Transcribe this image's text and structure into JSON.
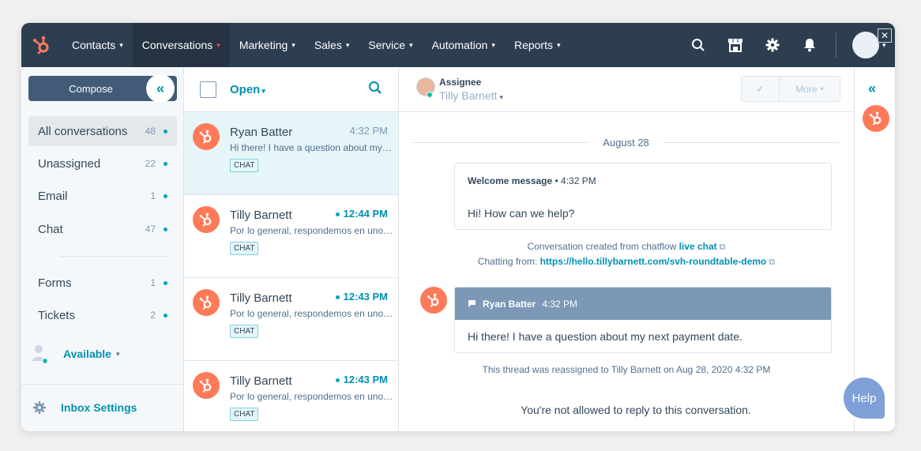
{
  "nav": {
    "items": [
      {
        "label": "Contacts"
      },
      {
        "label": "Conversations"
      },
      {
        "label": "Marketing"
      },
      {
        "label": "Sales"
      },
      {
        "label": "Service"
      },
      {
        "label": "Automation"
      },
      {
        "label": "Reports"
      }
    ],
    "active": "Conversations",
    "icons": [
      "search-icon",
      "marketplace-icon",
      "gear-icon",
      "bell-icon"
    ]
  },
  "sidebar": {
    "compose_label": "Compose",
    "items": [
      {
        "label": "All conversations",
        "count": "48"
      },
      {
        "label": "Unassigned",
        "count": "22"
      },
      {
        "label": "Email",
        "count": "1"
      },
      {
        "label": "Chat",
        "count": "47"
      },
      {
        "label": "Forms",
        "count": "1"
      },
      {
        "label": "Tickets",
        "count": "2"
      }
    ],
    "availability": "Available",
    "settings_label": "Inbox Settings"
  },
  "list": {
    "filter": "Open",
    "conversations": [
      {
        "name": "Ryan Batter",
        "time": "4:32 PM",
        "preview": "Hi there! I have a question about my next payment date.",
        "tag": "CHAT"
      },
      {
        "name": "Tilly Barnett",
        "time": "12:44 PM",
        "preview": "Por lo general, respondemos en unos minutos.",
        "tag": "CHAT"
      },
      {
        "name": "Tilly Barnett",
        "time": "12:43 PM",
        "preview": "Por lo general, respondemos en unos minutos.",
        "tag": "CHAT"
      },
      {
        "name": "Tilly Barnett",
        "time": "12:43 PM",
        "preview": "Por lo general, respondemos en unos minutos.",
        "tag": "CHAT"
      }
    ]
  },
  "main": {
    "assignee_label": "Assignee",
    "assignee_name": "Tilly Barnett",
    "more_label": "More",
    "date": "August 28",
    "welcome": {
      "title": "Welcome message",
      "time": "4:32 PM",
      "text": "Hi! How can we help?"
    },
    "created_prefix": "Conversation created from chatflow ",
    "created_link": "live chat",
    "chatting_prefix": "Chatting from: ",
    "chatting_link": "https://hello.tillybarnett.com/svh-roundtable-demo",
    "message": {
      "sender": "Ryan Batter",
      "time": "4:32 PM",
      "text": "Hi there! I have a question about my next payment date."
    },
    "reassigned": "This thread was reassigned to Tilly Barnett on Aug 28, 2020 4:32 PM",
    "no_reply": "You're not allowed to reply to this conversation."
  },
  "help_label": "Help",
  "colors": {
    "nav_bg": "#2d3e50",
    "accent": "#0091ae",
    "brand": "#ff7a59"
  }
}
